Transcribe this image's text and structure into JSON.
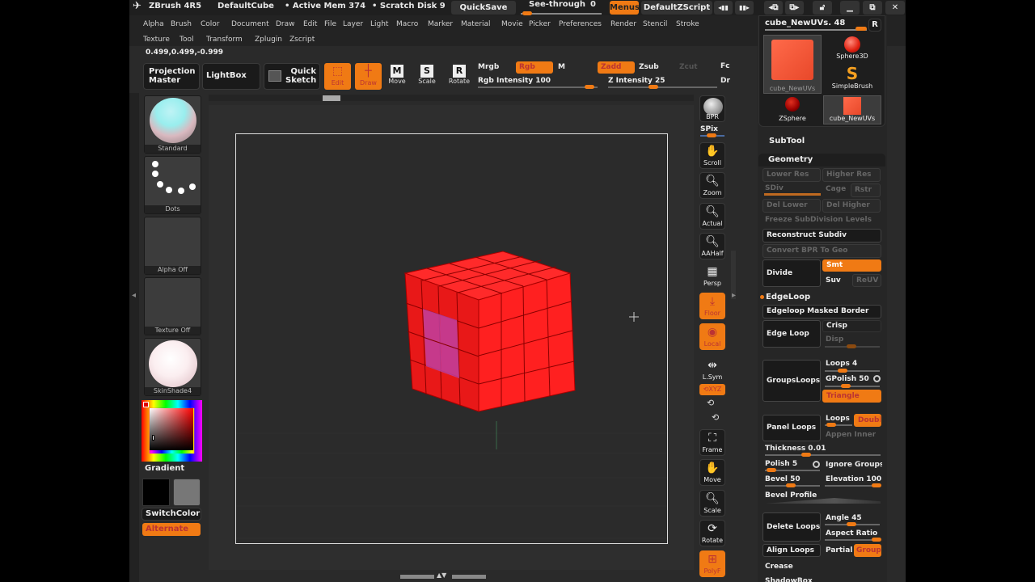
{
  "titlebar": {
    "app_name": "ZBrush 4R5",
    "document": "DefaultCube",
    "active_mem": "• Active Mem 374",
    "scratch_disk": "• Scratch Disk 9",
    "quicksave": "QuickSave",
    "see_through_label": "See-through",
    "see_through_value": "0",
    "menus": "Menus",
    "default_zscript": "DefaultZScript",
    "icons": [
      "tray-left-icon",
      "tray-right-icon",
      "prev-layout-icon",
      "next-layout-icon",
      "lock-icon",
      "minimize-icon",
      "restore-icon",
      "close-icon"
    ]
  },
  "menubar": {
    "row1": [
      "Alpha",
      "Brush",
      "Color",
      "Document",
      "Draw",
      "Edit",
      "File",
      "Layer",
      "Light",
      "Macro",
      "Marker",
      "Material",
      "Movie",
      "Picker",
      "Preferences",
      "Render",
      "Stencil",
      "Stroke"
    ],
    "row2": [
      "Texture",
      "Tool",
      "Transform",
      "Zplugin",
      "Zscript"
    ]
  },
  "coords": "0.499,0.499,-0.999",
  "toolbar": {
    "projection_master": "Projection Master",
    "lightbox": "LightBox",
    "quick_sketch": "Quick Sketch",
    "edit": "Edit",
    "draw": "Draw",
    "move": "Move",
    "scale": "Scale",
    "rotate": "Rotate",
    "move_key": "M",
    "scale_key": "S",
    "rotate_key": "R",
    "mrgb": "Mrgb",
    "rgb": "Rgb",
    "m": "M",
    "zadd": "Zadd",
    "zsub": "Zsub",
    "zcut": "Zcut",
    "rgb_intensity": "Rgb Intensity 100",
    "rgb_intensity_value": 100,
    "z_intensity": "Z Intensity 25",
    "z_intensity_value": 25,
    "focal_cut": "Fc",
    "draw_size_cut": "Dr",
    "see_through_value": 0
  },
  "left_shelf": {
    "brush": "Standard",
    "stroke": "Dots",
    "alpha": "Alpha Off",
    "texture": "Texture Off",
    "material": "SkinShade4",
    "gradient": "Gradient",
    "switch_color": "SwitchColor",
    "alternate": "Alternate"
  },
  "right_shelf": [
    {
      "label": "BPR",
      "icon": "bpr-sphere-icon"
    },
    {
      "label": "SPix",
      "icon": "spix-slider"
    },
    {
      "label": "Scroll",
      "icon": "hand-scroll-icon"
    },
    {
      "label": "Zoom",
      "icon": "magnifier-zoom-icon"
    },
    {
      "label": "Actual",
      "icon": "magnifier-actual-icon"
    },
    {
      "label": "AAHalf",
      "icon": "magnifier-aahalf-icon"
    },
    {
      "label": "Persp",
      "icon": "perspective-grid-icon"
    },
    {
      "label": "Floor",
      "icon": "floor-icon"
    },
    {
      "label": "Local",
      "icon": "local-transform-icon"
    },
    {
      "label": "L.Sym",
      "icon": "local-symmetry-icon"
    },
    {
      "label": "XYZ",
      "icon": "rotate-xyz-icon"
    },
    {
      "label": "Y",
      "icon": "rotate-y-icon"
    },
    {
      "label": "Z",
      "icon": "rotate-z-icon"
    },
    {
      "label": "Frame",
      "icon": "frame-icon"
    },
    {
      "label": "Move",
      "icon": "move-hand-icon"
    },
    {
      "label": "Scale",
      "icon": "scale-magnifier-icon"
    },
    {
      "label": "Rotate",
      "icon": "rotate-lock-icon"
    },
    {
      "label": "PolyF",
      "icon": "polyframe-icon"
    }
  ],
  "tool_panel": {
    "current_tool": "cube_NewUVs. 48",
    "r_button": "R",
    "tools": [
      "cube_NewUVs",
      "Sphere3D",
      "SimpleBrush",
      "ZSphere",
      "cube_NewUVs"
    ],
    "subtool": "SubTool",
    "geometry": "Geometry",
    "lower_res": "Lower Res",
    "higher_res": "Higher Res",
    "sdiv": "SDiv",
    "cage": "Cage",
    "rstr": "Rstr",
    "del_lower": "Del Lower",
    "del_higher": "Del Higher",
    "freeze": "Freeze SubDivision Levels",
    "reconstruct": "Reconstruct Subdiv",
    "convert_bpr": "Convert BPR To Geo",
    "divide": "Divide",
    "smt": "Smt",
    "suv": "Suv",
    "reuv": "ReUV",
    "edgeloop_header": "EdgeLoop",
    "edgeloop_masked": "Edgeloop Masked Border",
    "edge_loop": "Edge Loop",
    "crisp": "Crisp",
    "disp": "Disp",
    "groups_loops": "GroupsLoops",
    "loops": "Loops 4",
    "gpolish": "GPolish 50",
    "triangle": "Triangle",
    "panel_loops": "Panel Loops",
    "loops2": "Loops",
    "double": "Double",
    "appen_inner": "Appen Inner",
    "thickness": "Thickness 0.01",
    "polish": "Polish 5",
    "ignore_groups": "Ignore Groups",
    "bevel": "Bevel 50",
    "elevation": "Elevation 100",
    "bevel_profile": "Bevel Profile",
    "delete_loops": "Delete Loops",
    "angle": "Angle 45",
    "aspect_ratio": "Aspect Ratio",
    "align_loops": "Align Loops",
    "partial": "Partial",
    "groups": "Groups",
    "crease": "Crease",
    "shadowbox": "ShadowBox"
  },
  "colors": {
    "accent": "#f07a14",
    "mesh": "#ff2020",
    "masked": "#c040a0"
  }
}
